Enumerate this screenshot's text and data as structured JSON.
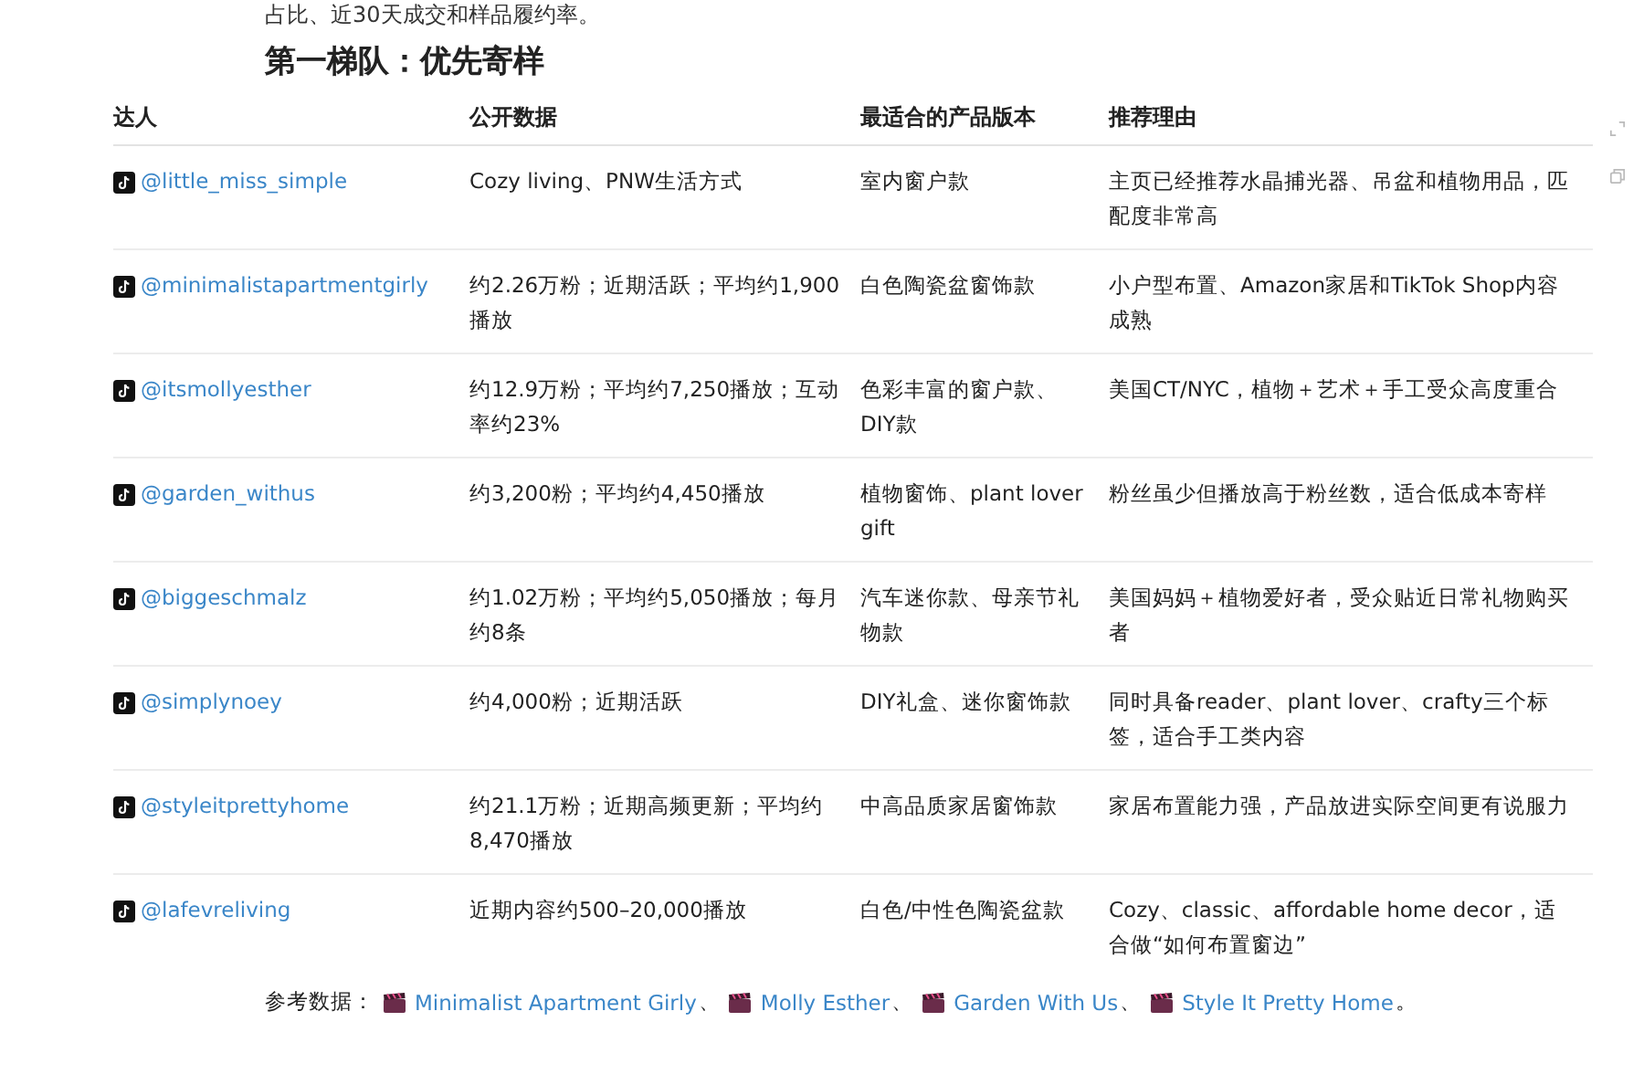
{
  "intro_text": "占比、近30天成交和样品履约率。",
  "heading": "第一梯队：优先寄样",
  "table": {
    "columns": [
      "达人",
      "公开数据",
      "最适合的产品版本",
      "推荐理由"
    ],
    "rows": [
      {
        "creator": "@little_miss_simple",
        "data": "Cozy living、PNW生活方式",
        "product": "室内窗户款",
        "reason": "主页已经推荐水晶捕光器、吊盆和植物用品，匹配度非常高"
      },
      {
        "creator": "@minimalistapartmentgirly",
        "data": "约2.26万粉；近期活跃；平均约1,900播放",
        "product": "白色陶瓷盆窗饰款",
        "reason": "小户型布置、Amazon家居和TikTok Shop内容成熟"
      },
      {
        "creator": "@itsmollyesther",
        "data": "约12.9万粉；平均约7,250播放；互动率约23%",
        "product": "色彩丰富的窗户款、DIY款",
        "reason": "美国CT/NYC，植物＋艺术＋手工受众高度重合"
      },
      {
        "creator": "@garden_withus",
        "data": "约3,200粉；平均约4,450播放",
        "product": "植物窗饰、plant lover gift",
        "reason": "粉丝虽少但播放高于粉丝数，适合低成本寄样"
      },
      {
        "creator": "@biggeschmalz",
        "data": "约1.02万粉；平均约5,050播放；每月约8条",
        "product": "汽车迷你款、母亲节礼物款",
        "reason": "美国妈妈＋植物爱好者，受众贴近日常礼物购买者"
      },
      {
        "creator": "@simplynoey",
        "data": "约4,000粉；近期活跃",
        "product": "DIY礼盒、迷你窗饰款",
        "reason": "同时具备reader、plant lover、crafty三个标签，适合手工类内容"
      },
      {
        "creator": "@styleitprettyhome",
        "data": "约21.1万粉；近期高频更新；平均约8,470播放",
        "product": "中高品质家居窗饰款",
        "reason": "家居布置能力强，产品放进实际空间更有说服力"
      },
      {
        "creator": "@lafevreliving",
        "data": "近期内容约500–20,000播放",
        "product": "白色/中性色陶瓷盆款",
        "reason": "Cozy、classic、affordable home decor，适合做“如何布置窗边”"
      }
    ]
  },
  "references": {
    "label": "参考数据：",
    "links": [
      "Minimalist Apartment Girly",
      "Molly Esther",
      "Garden With Us",
      "Style It Pretty Home"
    ],
    "separator": "、",
    "end": "。"
  }
}
